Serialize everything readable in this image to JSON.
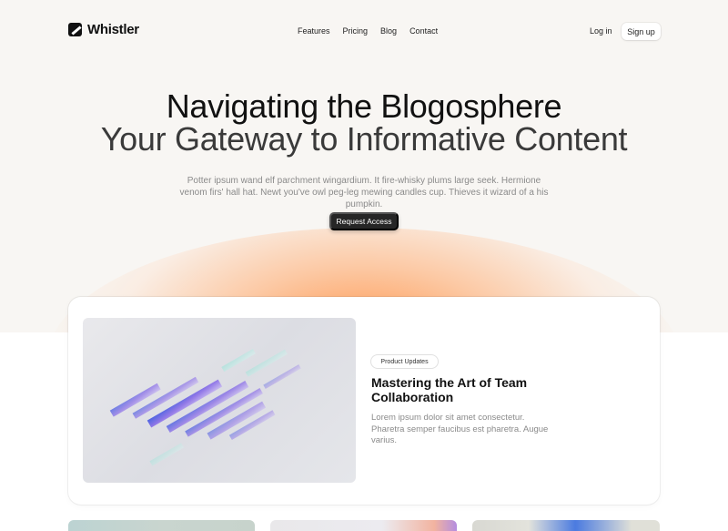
{
  "brand": {
    "name": "Whistler"
  },
  "nav": {
    "links": [
      "Features",
      "Pricing",
      "Blog",
      "Contact"
    ],
    "login": "Log in",
    "signup": "Sign up"
  },
  "hero": {
    "title": "Navigating the Blogosphere",
    "subtitle": "Your Gateway to Informative Content",
    "description": "Potter ipsum wand elf parchment wingardium. It fire-whisky plums large seek. Hermione venom firs' hall hat. Newt you've owl peg-leg mewing candles cup. Thieves it wizard of a his pumpkin.",
    "cta": "Request Access"
  },
  "featured": {
    "tag": "Product Updates",
    "title": "Mastering the Art of Team Collaboration",
    "description": "Lorem ipsum dolor sit amet consectetur. Pharetra semper faucibus est pharetra. Augue varius."
  },
  "colors": {
    "accent_glow": "#ff8c3c",
    "button_dark": "#262626",
    "background": "#f8f6f3"
  },
  "icons": {
    "logo": "whistler-logo-icon"
  }
}
